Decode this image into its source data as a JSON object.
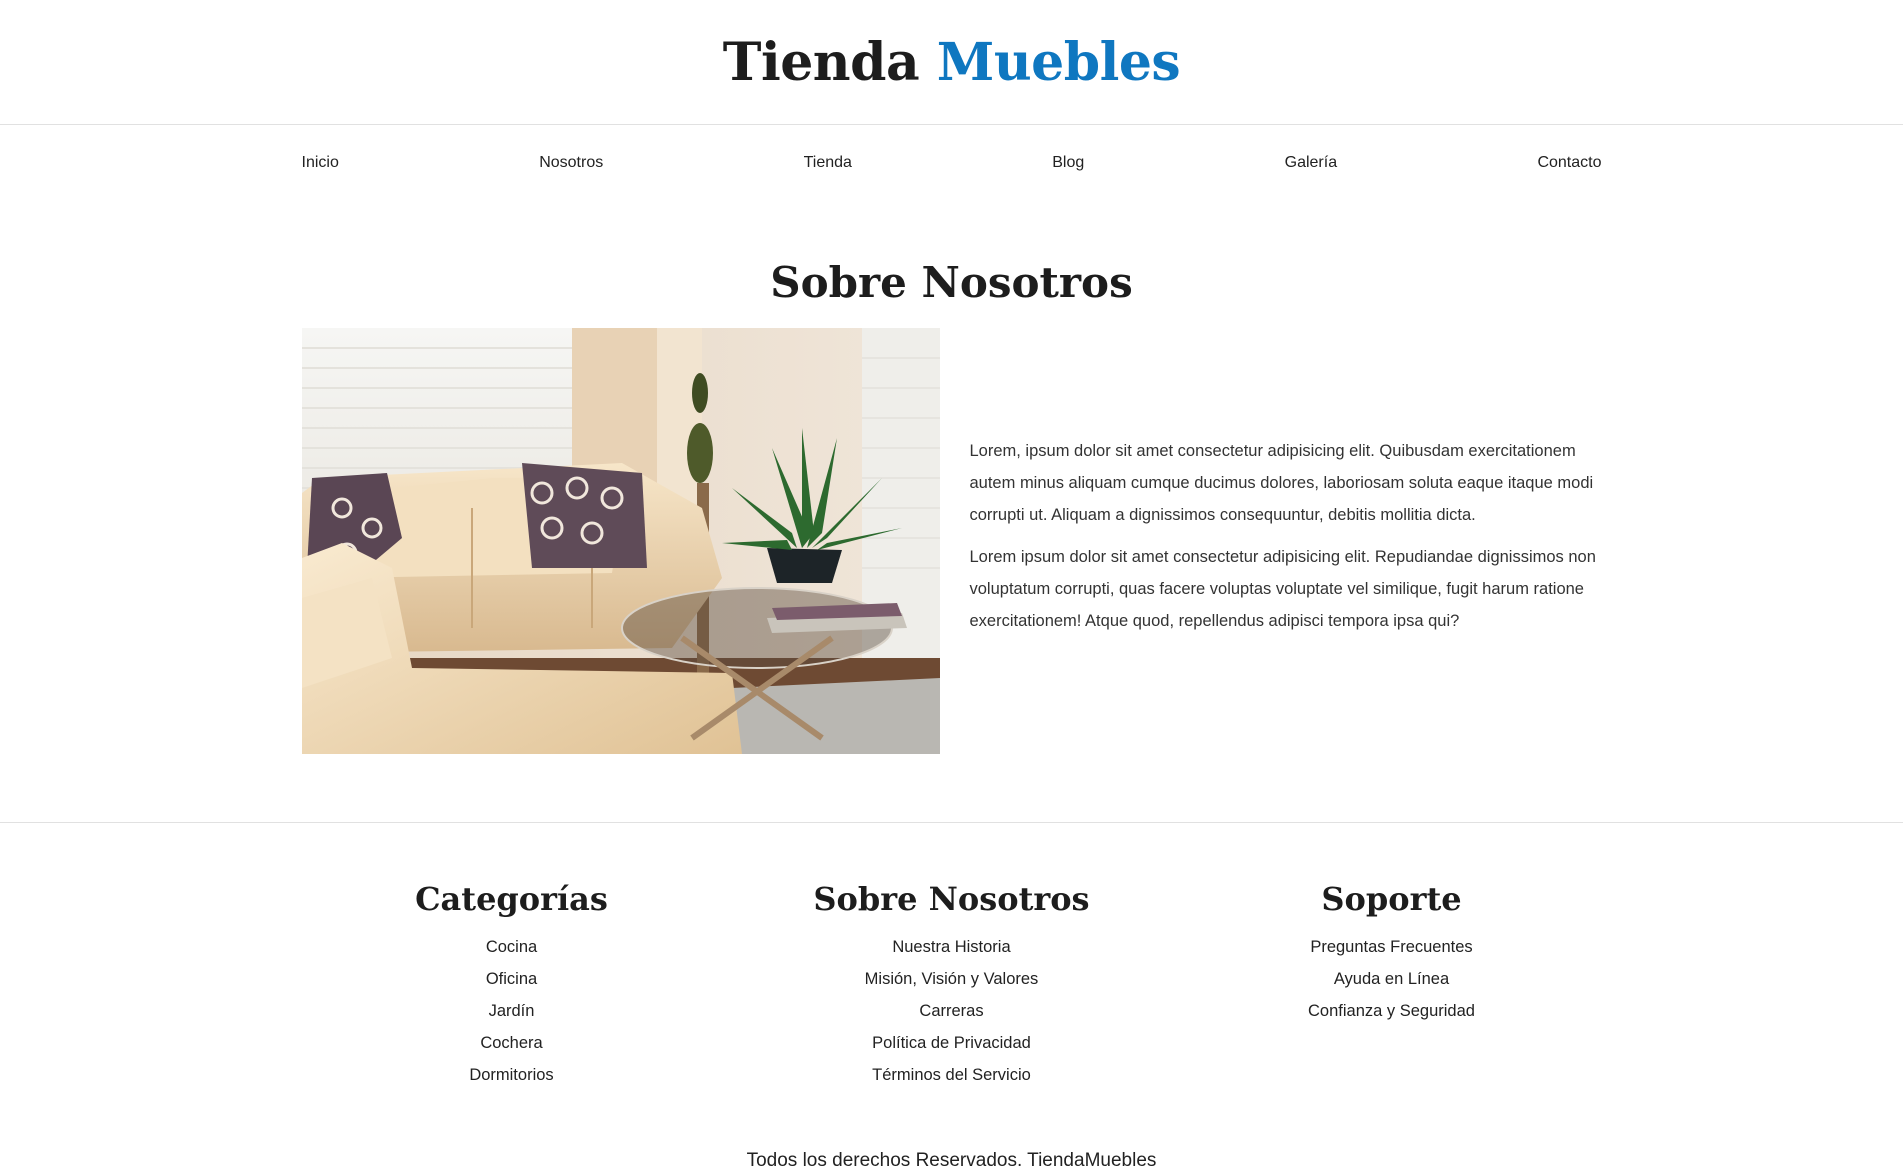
{
  "header": {
    "logo_part1": "Tienda",
    "logo_part2": "Muebles"
  },
  "nav": {
    "items": [
      "Inicio",
      "Nosotros",
      "Tienda",
      "Blog",
      "Galería",
      "Contacto"
    ]
  },
  "about": {
    "title": "Sobre Nosotros",
    "paragraphs": [
      "Lorem, ipsum dolor sit amet consectetur adipisicing elit. Quibusdam exercitationem autem minus aliquam cumque ducimus dolores, laboriosam soluta eaque itaque modi corrupti ut. Aliquam a dignissimos consequuntur, debitis mollitia dicta.",
      "Lorem ipsum dolor sit amet consectetur adipisicing elit. Repudiandae dignissimos non voluptatum corrupti, quas facere voluptas voluptate vel similique, fugit harum ratione exercitationem! Atque quod, repellendus adipisci tempora ipsa qui?"
    ]
  },
  "footer": {
    "columns": [
      {
        "title": "Categorías",
        "links": [
          "Cocina",
          "Oficina",
          "Jardín",
          "Cochera",
          "Dormitorios"
        ]
      },
      {
        "title": "Sobre Nosotros",
        "links": [
          "Nuestra Historia",
          "Misión, Visión y Valores",
          "Carreras",
          "Política de Privacidad",
          "Términos del Servicio"
        ]
      },
      {
        "title": "Soporte",
        "links": [
          "Preguntas Frecuentes",
          "Ayuda en Línea",
          "Confianza y Seguridad"
        ]
      }
    ],
    "copyright": "Todos los derechos Reservados. TiendaMuebles"
  },
  "colors": {
    "accent": "#0f77c0",
    "text": "#222222",
    "divider": "#e1e1e1"
  }
}
